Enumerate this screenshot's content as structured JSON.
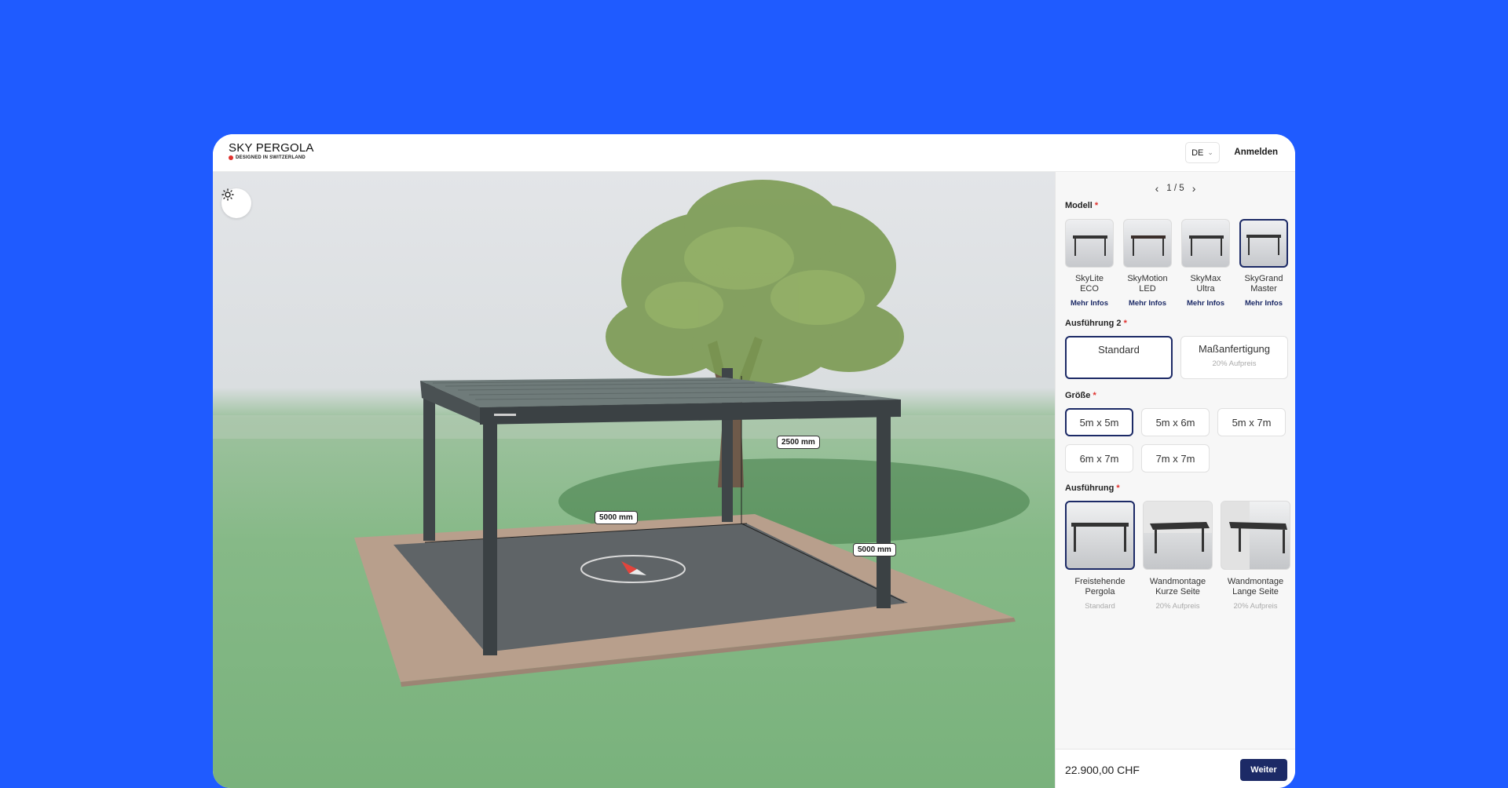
{
  "brand": {
    "name": "SKY PERGOLA",
    "tagline": "DESIGNED IN SWITZERLAND"
  },
  "header": {
    "language": "DE",
    "login_label": "Anmelden"
  },
  "viewport": {
    "light_toggle_icon": "sun-icon",
    "dimensions": {
      "height": "2500 mm",
      "width": "5000 mm",
      "depth": "5000 mm"
    }
  },
  "config": {
    "pager": {
      "label": "1 / 5"
    },
    "model": {
      "label": "Modell",
      "required_mark": "*",
      "items": [
        {
          "name": "SkyLite ECO",
          "more": "Mehr Infos",
          "selected": false
        },
        {
          "name": "SkyMotion LED",
          "more": "Mehr Infos",
          "selected": false
        },
        {
          "name": "SkyMax Ultra",
          "more": "Mehr Infos",
          "selected": false
        },
        {
          "name": "SkyGrand Master",
          "more": "Mehr Infos",
          "selected": true
        }
      ]
    },
    "execution2": {
      "label": "Ausführung 2",
      "required_mark": "*",
      "options": [
        {
          "title": "Standard",
          "subtitle": "",
          "selected": true
        },
        {
          "title": "Maßanfertigung",
          "subtitle": "20% Aufpreis",
          "selected": false
        }
      ]
    },
    "size": {
      "label": "Größe",
      "required_mark": "*",
      "options": [
        {
          "label": "5m x 5m",
          "selected": true
        },
        {
          "label": "5m x 6m",
          "selected": false
        },
        {
          "label": "5m x 7m",
          "selected": false
        },
        {
          "label": "6m x 7m",
          "selected": false
        },
        {
          "label": "7m x 7m",
          "selected": false
        }
      ]
    },
    "mounting": {
      "label": "Ausführung",
      "required_mark": "*",
      "options": [
        {
          "name": "Freistehende Pergola",
          "sub": "Standard",
          "selected": true
        },
        {
          "name": "Wandmontage Kurze Seite",
          "sub": "20% Aufpreis",
          "selected": false
        },
        {
          "name": "Wandmontage Lange Seite",
          "sub": "20% Aufpreis",
          "selected": false
        }
      ]
    }
  },
  "footer": {
    "price": "22.900,00 CHF",
    "next_label": "Weiter"
  },
  "colors": {
    "background": "#1f5bff",
    "accent": "#1c2a66",
    "required": "#e0312d"
  }
}
